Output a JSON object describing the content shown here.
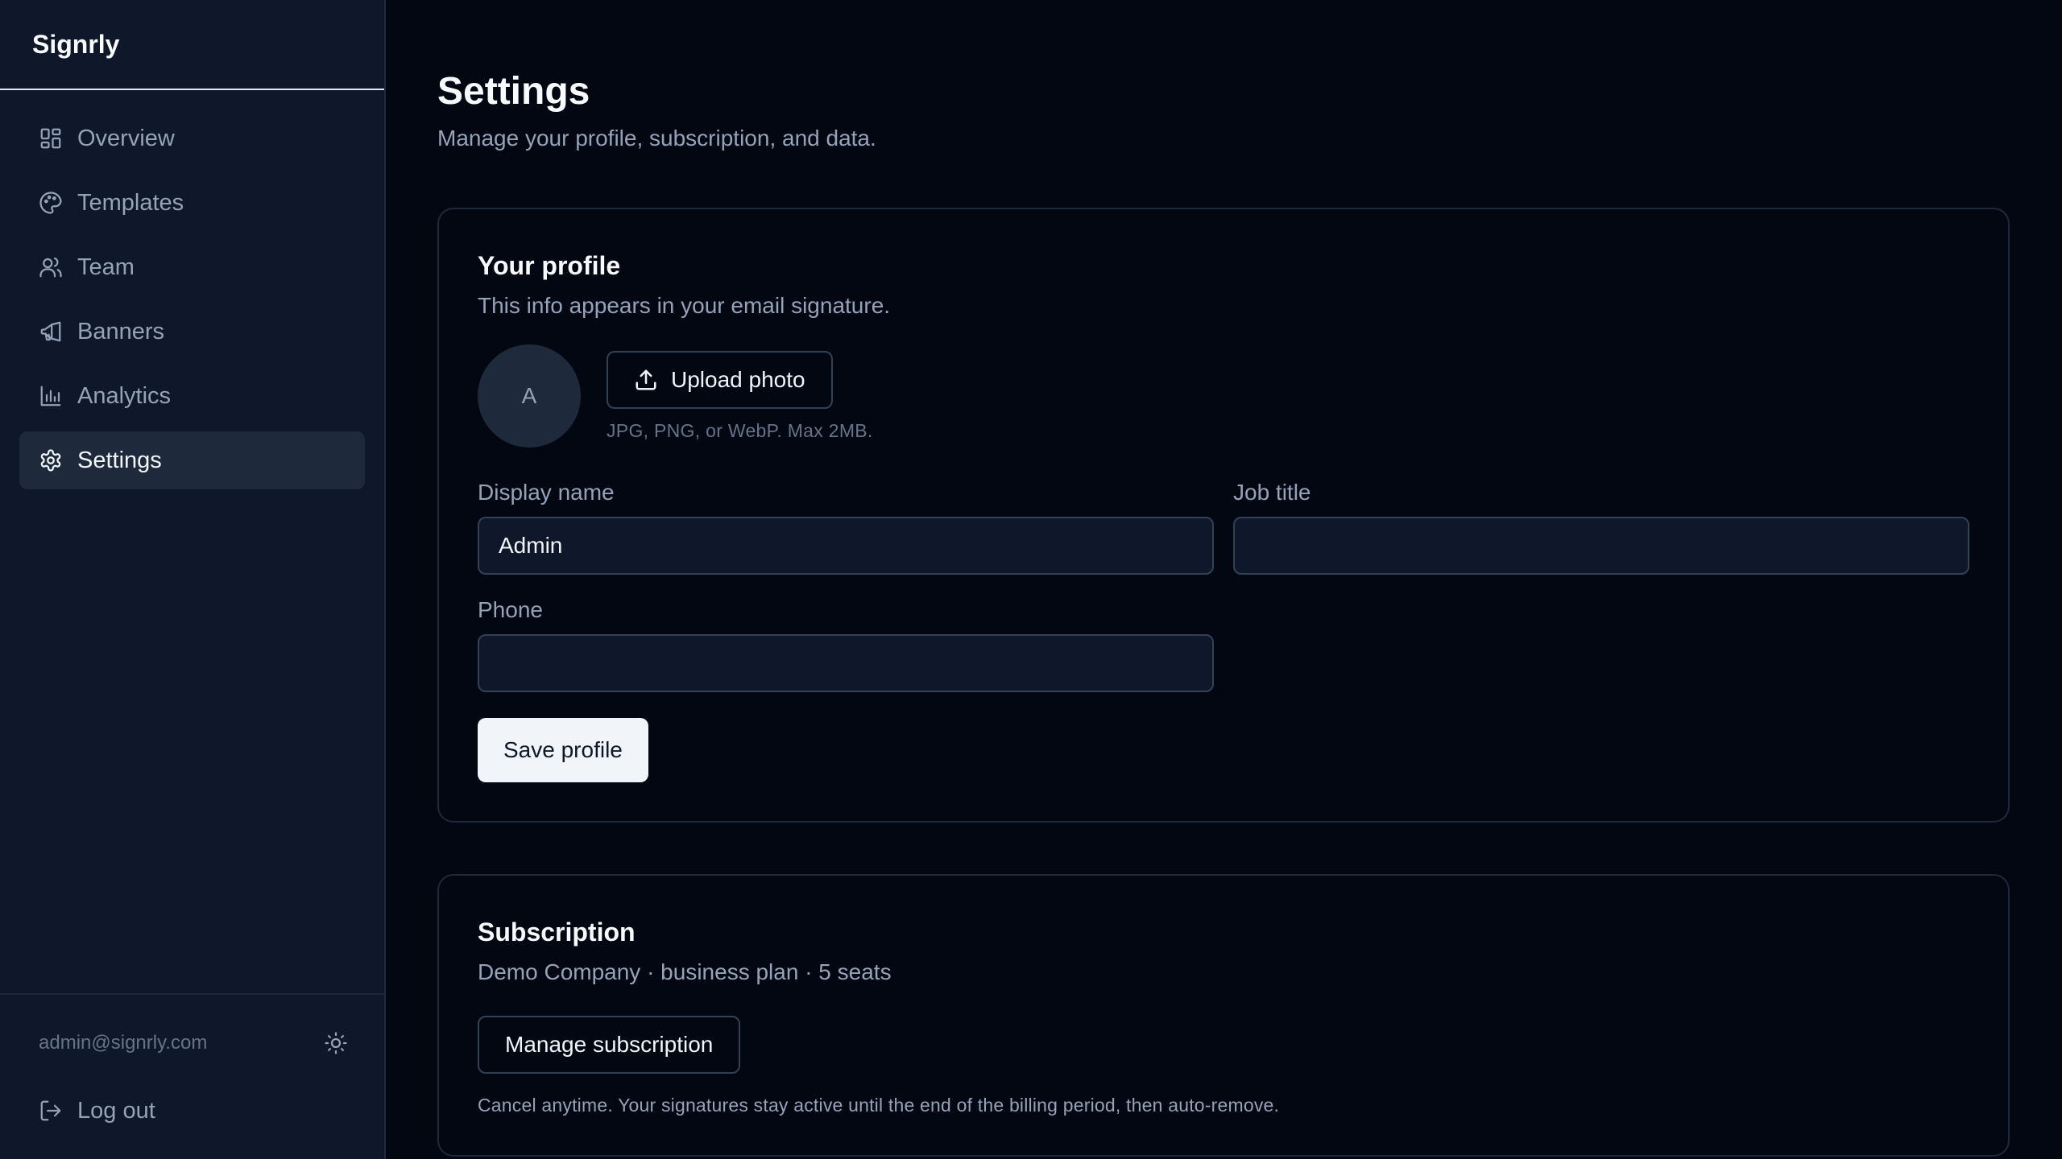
{
  "app": {
    "name": "Signrly"
  },
  "sidebar": {
    "items": [
      {
        "label": "Overview",
        "icon": "layout-dashboard-icon"
      },
      {
        "label": "Templates",
        "icon": "palette-icon"
      },
      {
        "label": "Team",
        "icon": "users-icon"
      },
      {
        "label": "Banners",
        "icon": "megaphone-icon"
      },
      {
        "label": "Analytics",
        "icon": "bar-chart-icon"
      },
      {
        "label": "Settings",
        "icon": "gear-icon",
        "active": true
      }
    ],
    "account_email": "admin@signrly.com",
    "theme_icon": "sun-icon",
    "logout_label": "Log out"
  },
  "page": {
    "title": "Settings",
    "subtitle": "Manage your profile, subscription, and data."
  },
  "profile": {
    "title": "Your profile",
    "description": "This info appears in your email signature.",
    "avatar_initial": "A",
    "upload_label": "Upload photo",
    "upload_hint": "JPG, PNG, or WebP. Max 2MB.",
    "display_name_label": "Display name",
    "display_name_value": "Admin",
    "job_title_label": "Job title",
    "job_title_value": "",
    "phone_label": "Phone",
    "phone_value": "",
    "save_label": "Save profile"
  },
  "subscription": {
    "title": "Subscription",
    "summary": "Demo Company · business plan · 5 seats",
    "manage_label": "Manage subscription",
    "note": "Cancel anytime. Your signatures stay active until the end of the billing period, then auto-remove."
  },
  "colors": {
    "background": "#030712",
    "sidebar": "#0f172a",
    "active_item": "#1e293b",
    "primary_button": "#f1f5f9"
  }
}
